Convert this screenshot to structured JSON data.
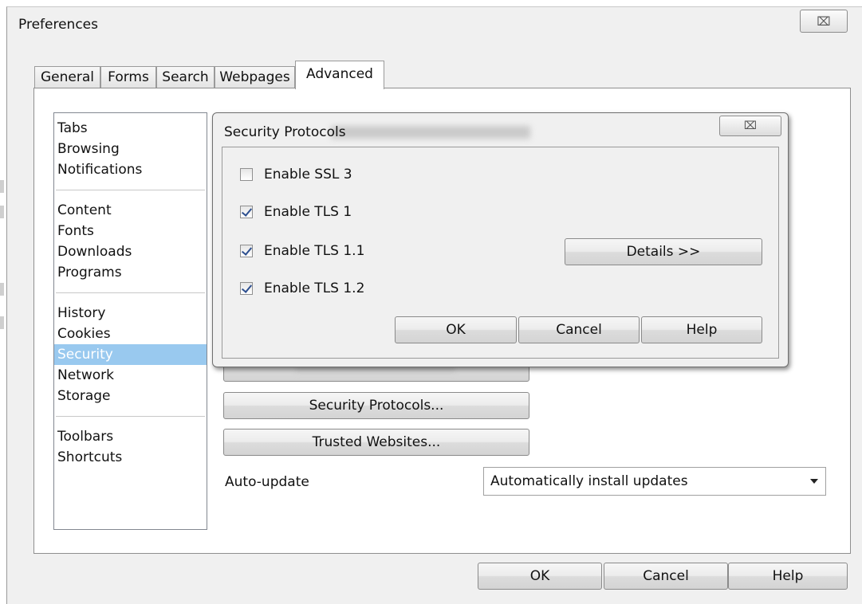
{
  "main_window": {
    "title": "Preferences",
    "close_glyph": "⌧",
    "tabs": [
      {
        "label": "General",
        "active": false
      },
      {
        "label": "Forms",
        "active": false
      },
      {
        "label": "Search",
        "active": false
      },
      {
        "label": "Webpages",
        "active": false
      },
      {
        "label": "Advanced",
        "active": true
      }
    ],
    "categories": [
      [
        "Tabs",
        "Browsing",
        "Notifications"
      ],
      [
        "Content",
        "Fonts",
        "Downloads",
        "Programs"
      ],
      [
        "History",
        "Cookies",
        "Security",
        "Network",
        "Storage"
      ],
      [
        "Toolbars",
        "Shortcuts"
      ]
    ],
    "selected_category": "Security",
    "security_protocols_button": "Security Protocols...",
    "trusted_websites_button": "Trusted Websites...",
    "auto_update_label": "Auto-update",
    "auto_update_value": "Automatically install updates",
    "ok_button": "OK",
    "cancel_button": "Cancel",
    "help_button": "Help"
  },
  "dialog": {
    "title": "Security Protocols",
    "close_glyph": "⌧",
    "options": [
      {
        "label": "Enable SSL 3",
        "checked": false
      },
      {
        "label": "Enable TLS 1",
        "checked": true
      },
      {
        "label": "Enable TLS 1.1",
        "checked": true
      },
      {
        "label": "Enable TLS 1.2",
        "checked": true
      }
    ],
    "details_button": "Details >>",
    "ok_button": "OK",
    "cancel_button": "Cancel",
    "help_button": "Help"
  },
  "colors": {
    "selected_category_bg": "#99c9ef",
    "window_bg": "#f0f0f0"
  }
}
